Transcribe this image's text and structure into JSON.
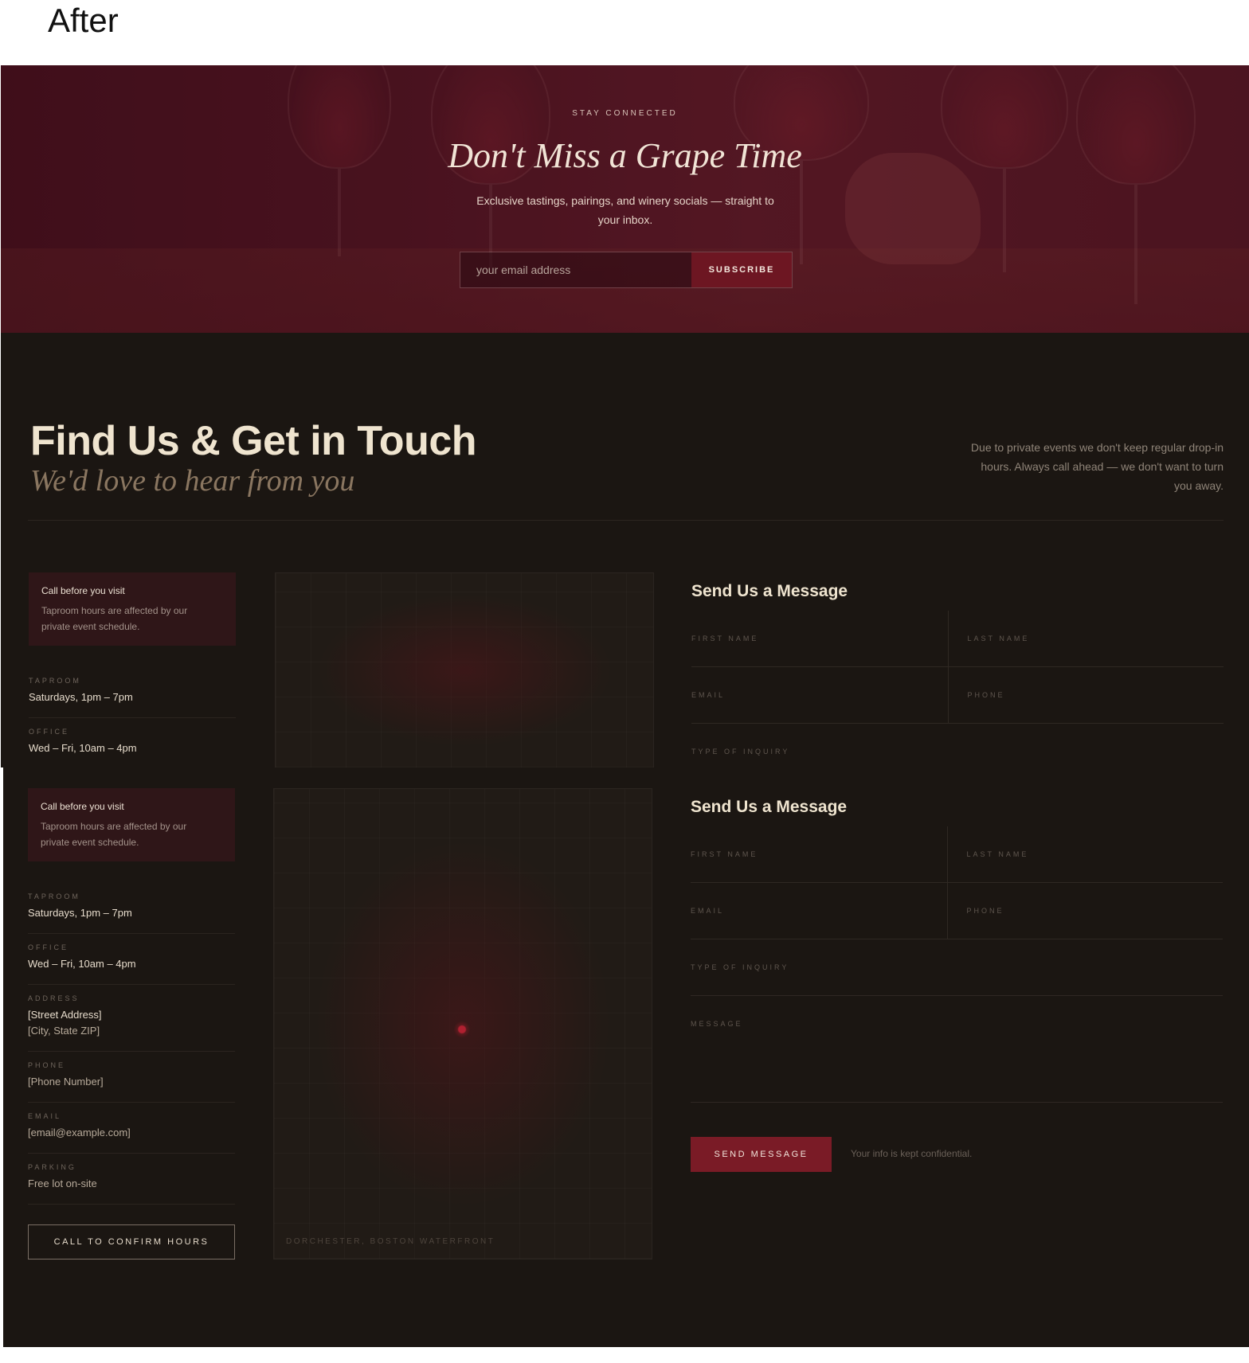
{
  "caption": "After",
  "newsletter": {
    "eyebrow": "STAY CONNECTED",
    "title": "Don't Miss a Grape Time",
    "subtitle": "Exclusive tastings, pairings, and winery socials — straight to your inbox.",
    "email_placeholder": "your email address",
    "subscribe_label": "SUBSCRIBE"
  },
  "contact": {
    "title": "Find Us & Get in Touch",
    "script": "We'd love to hear from you",
    "note": "Due to private events we don't keep regular drop-in hours. Always call ahead — we don't want to turn you away.",
    "callout": {
      "title": "Call before you visit",
      "text": "Taproom hours are affected by our private event schedule."
    },
    "info": [
      {
        "label": "TAPROOM",
        "value": "Saturdays, 1pm – 7pm"
      },
      {
        "label": "OFFICE",
        "value": "Wed – Fri, 10am – 4pm"
      },
      {
        "label": "ADDRESS",
        "value": "[Street Address]",
        "value2": "[City, State ZIP]"
      },
      {
        "label": "PHONE",
        "value": "[Phone Number]"
      },
      {
        "label": "EMAIL",
        "value": "[email@example.com]"
      },
      {
        "label": "PARKING",
        "value": "Free lot on-site"
      }
    ],
    "confirm_button": "CALL TO CONFIRM HOURS",
    "map_caption": "DORCHESTER, BOSTON WATERFRONT",
    "form": {
      "title": "Send Us a Message",
      "first_name": "FIRST NAME",
      "last_name": "LAST NAME",
      "email": "EMAIL",
      "phone": "PHONE",
      "inquiry": "TYPE OF INQUIRY",
      "message": "MESSAGE",
      "send_label": "SEND MESSAGE",
      "confidential": "Your info is kept confidential."
    }
  },
  "colors": {
    "background": "#1b1612",
    "accent": "#7a1b26",
    "heading": "#efe4cf",
    "callout_bg": "#2f1618"
  }
}
